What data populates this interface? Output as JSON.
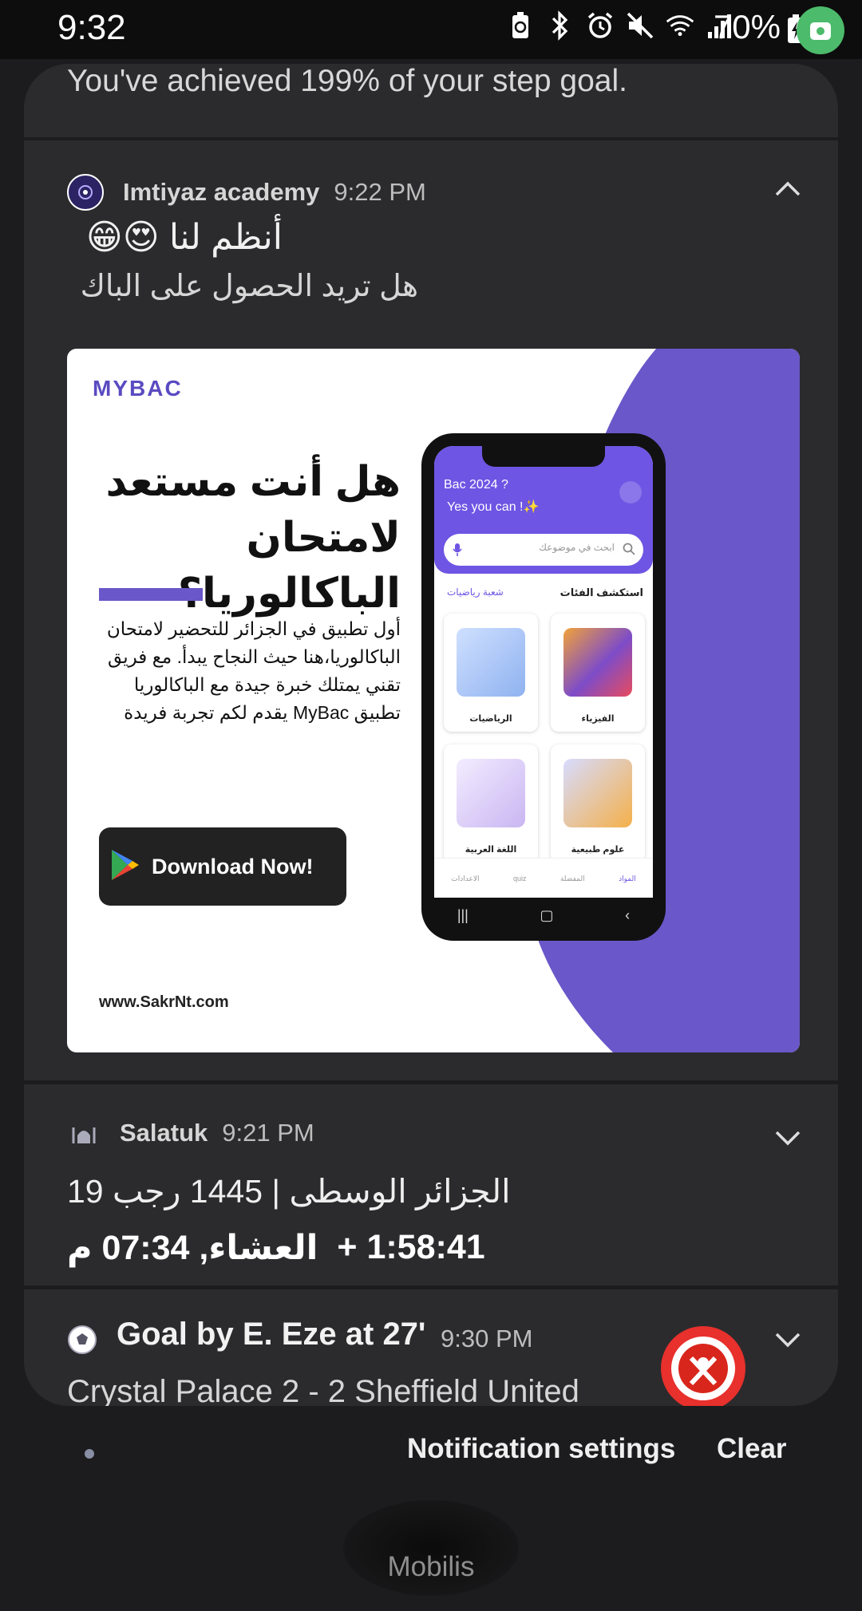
{
  "status_bar": {
    "time": "9:32",
    "battery": "70%",
    "icons": [
      "battery-saver-icon",
      "bluetooth-icon",
      "alarm-icon",
      "mute-icon",
      "wifi-icon",
      "signal-icon",
      "battery-icon",
      "screen-recorder-icon"
    ],
    "recorder_color": "#4cbb6b"
  },
  "steps": {
    "text": "You've achieved 199% of your step goal."
  },
  "imtiyaz": {
    "app_name": "Imtiyaz academy",
    "time": "9:22 PM",
    "title": "أنظم لنا 😍😁",
    "body": "هل تريد الحصول على الباك",
    "banner": {
      "logo": "MYBAC",
      "headline": "هل أنت مستعد لامتحان الباكالوريا؟",
      "paragraph": "أول تطبيق في الجزائر للتحضير لامتحان الباكالوريا،هنا حيث النجاح يبدأ. مع فريق تقني يمتلك خبرة جيدة مع الباكالوريا تطبيق MyBac يقدم لكم تجربة فريدة",
      "download": "Download Now!",
      "url": "www.SakrNt.com",
      "accent": "#6a57c9",
      "phone": {
        "greeting1": "Bac 2024 ?",
        "greeting2": "Yes you can !✨",
        "search_placeholder": "ابحث في موضوعك",
        "section": "استكشف الفئات",
        "section_alt": "شعبة رياضيات",
        "cards": [
          "الفيزياء",
          "الرياضيات",
          "علوم طبيعية",
          "اللغة العربية"
        ],
        "nav": [
          "المواد",
          "المفضلة",
          "quiz",
          "الاعدادات"
        ]
      }
    }
  },
  "salatuk": {
    "app_name": "Salatuk",
    "time": "9:21 PM",
    "line1": "الجزائر الوسطى  |  1445 رجب 19",
    "countdown": "+ 1:58:41",
    "prayer": "العشاء, 07:34 م"
  },
  "goal": {
    "title": "Goal by E. Eze at 27'",
    "time": "9:30 PM",
    "text": "Crystal Palace 2 - 2 Sheffield United"
  },
  "footer": {
    "settings": "Notification settings",
    "clear": "Clear",
    "carrier": "Mobilis"
  }
}
